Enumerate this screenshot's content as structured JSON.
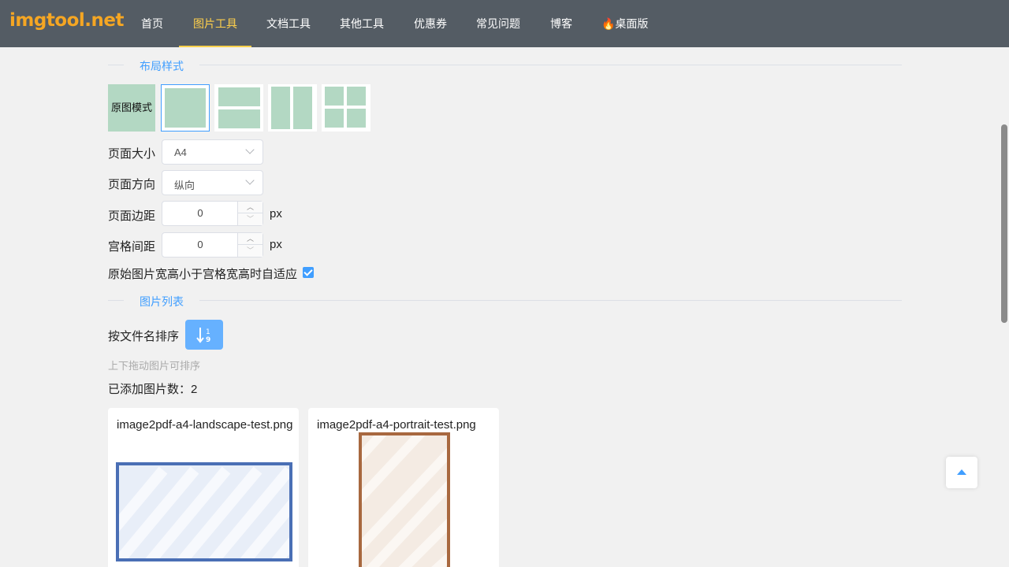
{
  "brand": {
    "logo_text": "imgtool.net",
    "logo_color": "#f5a623"
  },
  "nav": {
    "items": [
      {
        "label": "首页",
        "active": false
      },
      {
        "label": "图片工具",
        "active": true
      },
      {
        "label": "文档工具",
        "active": false
      },
      {
        "label": "其他工具",
        "active": false
      },
      {
        "label": "优惠券",
        "active": false
      },
      {
        "label": "常见问题",
        "active": false
      },
      {
        "label": "博客",
        "active": false
      },
      {
        "label": "🔥桌面版",
        "active": false
      }
    ]
  },
  "sections": {
    "layout_title": "布局样式",
    "list_title": "图片列表"
  },
  "layout": {
    "mode_label": "原图模式",
    "options": [
      "single",
      "two-rows",
      "two-columns",
      "grid-2x2"
    ],
    "selected": "single"
  },
  "form": {
    "page_size_label": "页面大小",
    "page_size_value": "A4",
    "orientation_label": "页面方向",
    "orientation_value": "纵向",
    "margin_label": "页面边距",
    "margin_value": "0",
    "margin_unit": "px",
    "gap_label": "宫格间距",
    "gap_value": "0",
    "gap_unit": "px",
    "autofit_label": "原始图片宽高小于宫格宽高时自适应",
    "autofit_checked": true
  },
  "list": {
    "sort_label": "按文件名排序",
    "sort_icon": "sort-numeric-asc-icon",
    "drag_hint": "上下拖动图片可排序",
    "count_label": "已添加图片数：",
    "count_value": "2",
    "images": [
      {
        "name": "image2pdf-a4-landscape-test.png",
        "orientation": "landscape",
        "frame_color": "#4a6fb5"
      },
      {
        "name": "image2pdf-a4-portrait-test.png",
        "orientation": "portrait",
        "frame_color": "#a8683f"
      }
    ]
  },
  "colors": {
    "accent": "#409eff",
    "nav_bg": "#545c64",
    "nav_active": "#ffd04b",
    "layout_cell": "#b3d8c3"
  }
}
